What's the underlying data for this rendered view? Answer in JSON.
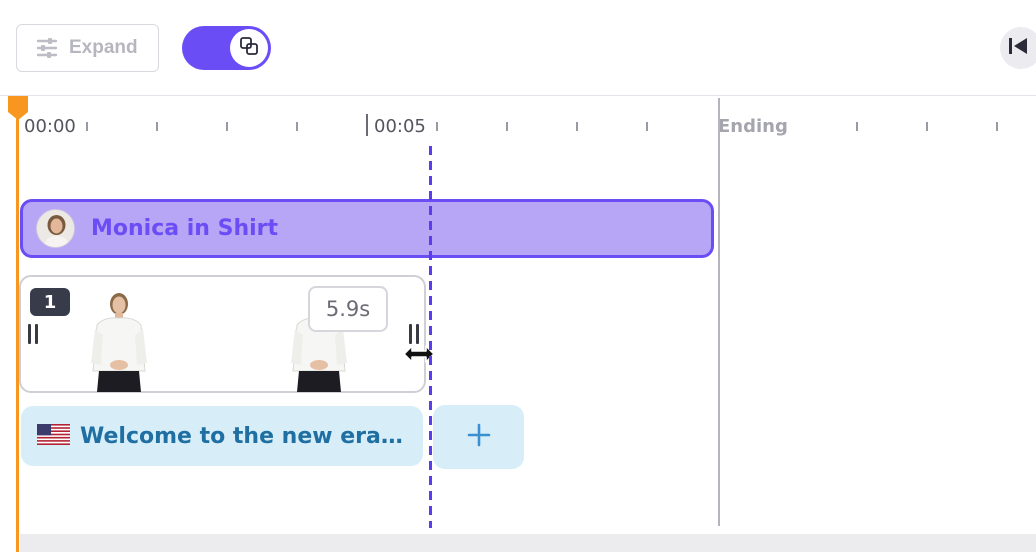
{
  "toolbar": {
    "expand_label": "Expand",
    "expand_icon": "sliders-icon",
    "toggle_icon": "overlap-squares-icon",
    "toggle_on": true,
    "skip_icon": "skip-to-start-icon"
  },
  "ruler": {
    "labels": [
      "00:00",
      "00:05"
    ],
    "end_label": "Ending"
  },
  "tracks": {
    "avatar": {
      "name": "Monica in Shirt"
    },
    "scene": {
      "number": "1",
      "duration": "5.9s"
    },
    "script": {
      "flag": "us-flag-icon",
      "text": "Welcome to the new era of ..."
    }
  },
  "colors": {
    "accent": "#6a4df5",
    "avatar_track": "#b6a6f5",
    "playhead": "#f8961f",
    "script_track": "#d7eef9",
    "script_text": "#1f6fa2"
  }
}
